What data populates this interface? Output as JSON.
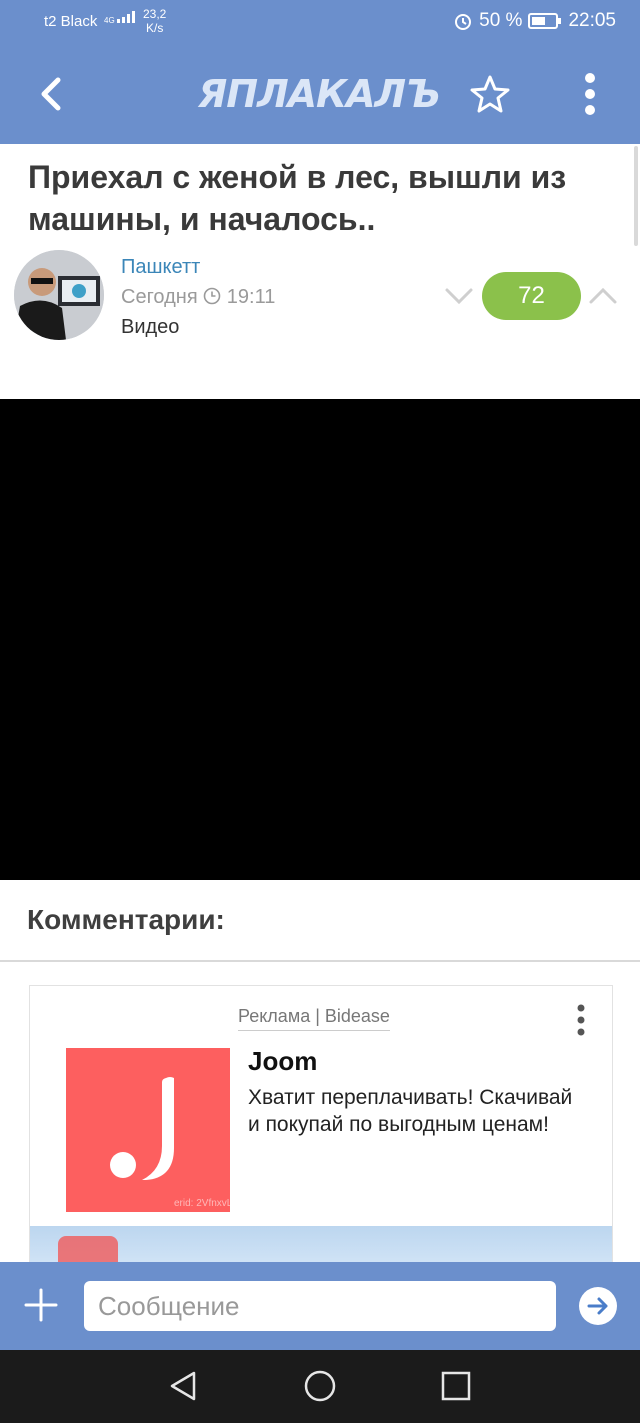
{
  "status_bar": {
    "carrier": "t2 Black",
    "network": "4G",
    "speed_value": "23,2",
    "speed_unit": "K/s",
    "battery": "50 %",
    "time": "22:05"
  },
  "app_bar": {
    "logo_text": "ЯПЛАКАЛЪ"
  },
  "post": {
    "title": "Приехал с женой в лес, вышли из машины, и началось..",
    "author": "Пашкетт",
    "date_label": "Сегодня",
    "time": "19:11",
    "category": "Видео",
    "score": "72"
  },
  "comments": {
    "heading": "Комментарии:"
  },
  "ad": {
    "label": "Реклама | Bidease",
    "brand": "Joom",
    "text": "Хватит переплачивать! Скачивай и покупай по выгодным ценам!",
    "erid": "erid: 2VfnxvLfqpU"
  },
  "composer": {
    "placeholder": "Сообщение"
  },
  "colors": {
    "app_blue": "#6b8fcc",
    "score_green": "#8bc14b",
    "ad_red": "#fd5f5f",
    "author_link": "#3b86b8"
  },
  "icons": [
    "back-arrow-icon",
    "star-icon",
    "more-vert-icon",
    "clock-icon",
    "chevron-down-icon",
    "chevron-up-icon",
    "plus-icon",
    "send-icon",
    "nav-back-icon",
    "nav-home-icon",
    "nav-recents-icon"
  ]
}
